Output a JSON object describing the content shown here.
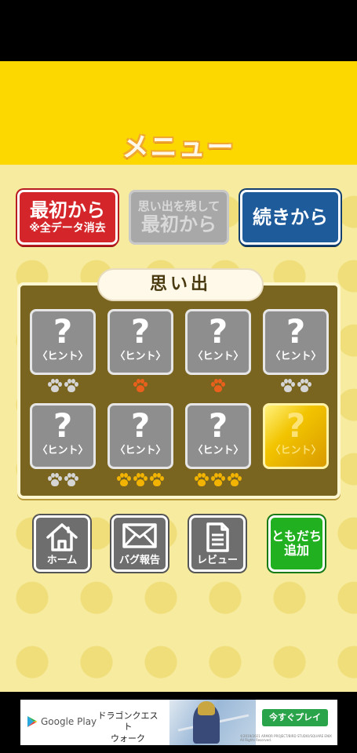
{
  "header": {
    "title": "メニュー"
  },
  "top_buttons": {
    "start": {
      "line1": "最初から",
      "line2": "※全データ消去"
    },
    "keep": {
      "line1": "思い出を残して",
      "line2": "最初から"
    },
    "continue": {
      "label": "続きから"
    }
  },
  "memories": {
    "title": "思い出",
    "cards": [
      {
        "mark": "?",
        "hint": "〈ヒント〉",
        "paws": 2,
        "paw_color": "silver",
        "state": "locked"
      },
      {
        "mark": "?",
        "hint": "〈ヒント〉",
        "paws": 1,
        "paw_color": "orange",
        "state": "locked"
      },
      {
        "mark": "?",
        "hint": "〈ヒント〉",
        "paws": 1,
        "paw_color": "orange",
        "state": "locked"
      },
      {
        "mark": "?",
        "hint": "〈ヒント〉",
        "paws": 2,
        "paw_color": "silver",
        "state": "locked"
      },
      {
        "mark": "?",
        "hint": "〈ヒント〉",
        "paws": 2,
        "paw_color": "silver",
        "state": "locked"
      },
      {
        "mark": "?",
        "hint": "〈ヒント〉",
        "paws": 3,
        "paw_color": "gold",
        "state": "locked"
      },
      {
        "mark": "?",
        "hint": "〈ヒント〉",
        "paws": 3,
        "paw_color": "gold",
        "state": "locked"
      },
      {
        "mark": "?",
        "hint": "〈ヒント〉",
        "paws": 0,
        "paw_color": "gold",
        "state": "gold"
      }
    ]
  },
  "bottom_nav": {
    "home": {
      "label": "ホーム",
      "icon": "home-icon"
    },
    "bug": {
      "label": "バグ報告",
      "icon": "mail-icon"
    },
    "review": {
      "label": "レビュー",
      "icon": "document-icon"
    },
    "friend": {
      "line1": "ともだち",
      "line2": "追加"
    }
  },
  "ad": {
    "store": "Google Play",
    "title_line1": "ドラゴンクエスト",
    "title_line2": "ウォーク",
    "cta": "今すぐプレイ",
    "copyright": "©2019/2021 ARMOR PROJECT/BIRD STUDIO/SQUARE ENIX All Rights Reserved."
  },
  "colors": {
    "header_yellow": "#fcd800",
    "start_red": "#d4262a",
    "continue_blue": "#1e5b9b",
    "panel_brown": "#7a6520",
    "line_green": "#21b020"
  }
}
